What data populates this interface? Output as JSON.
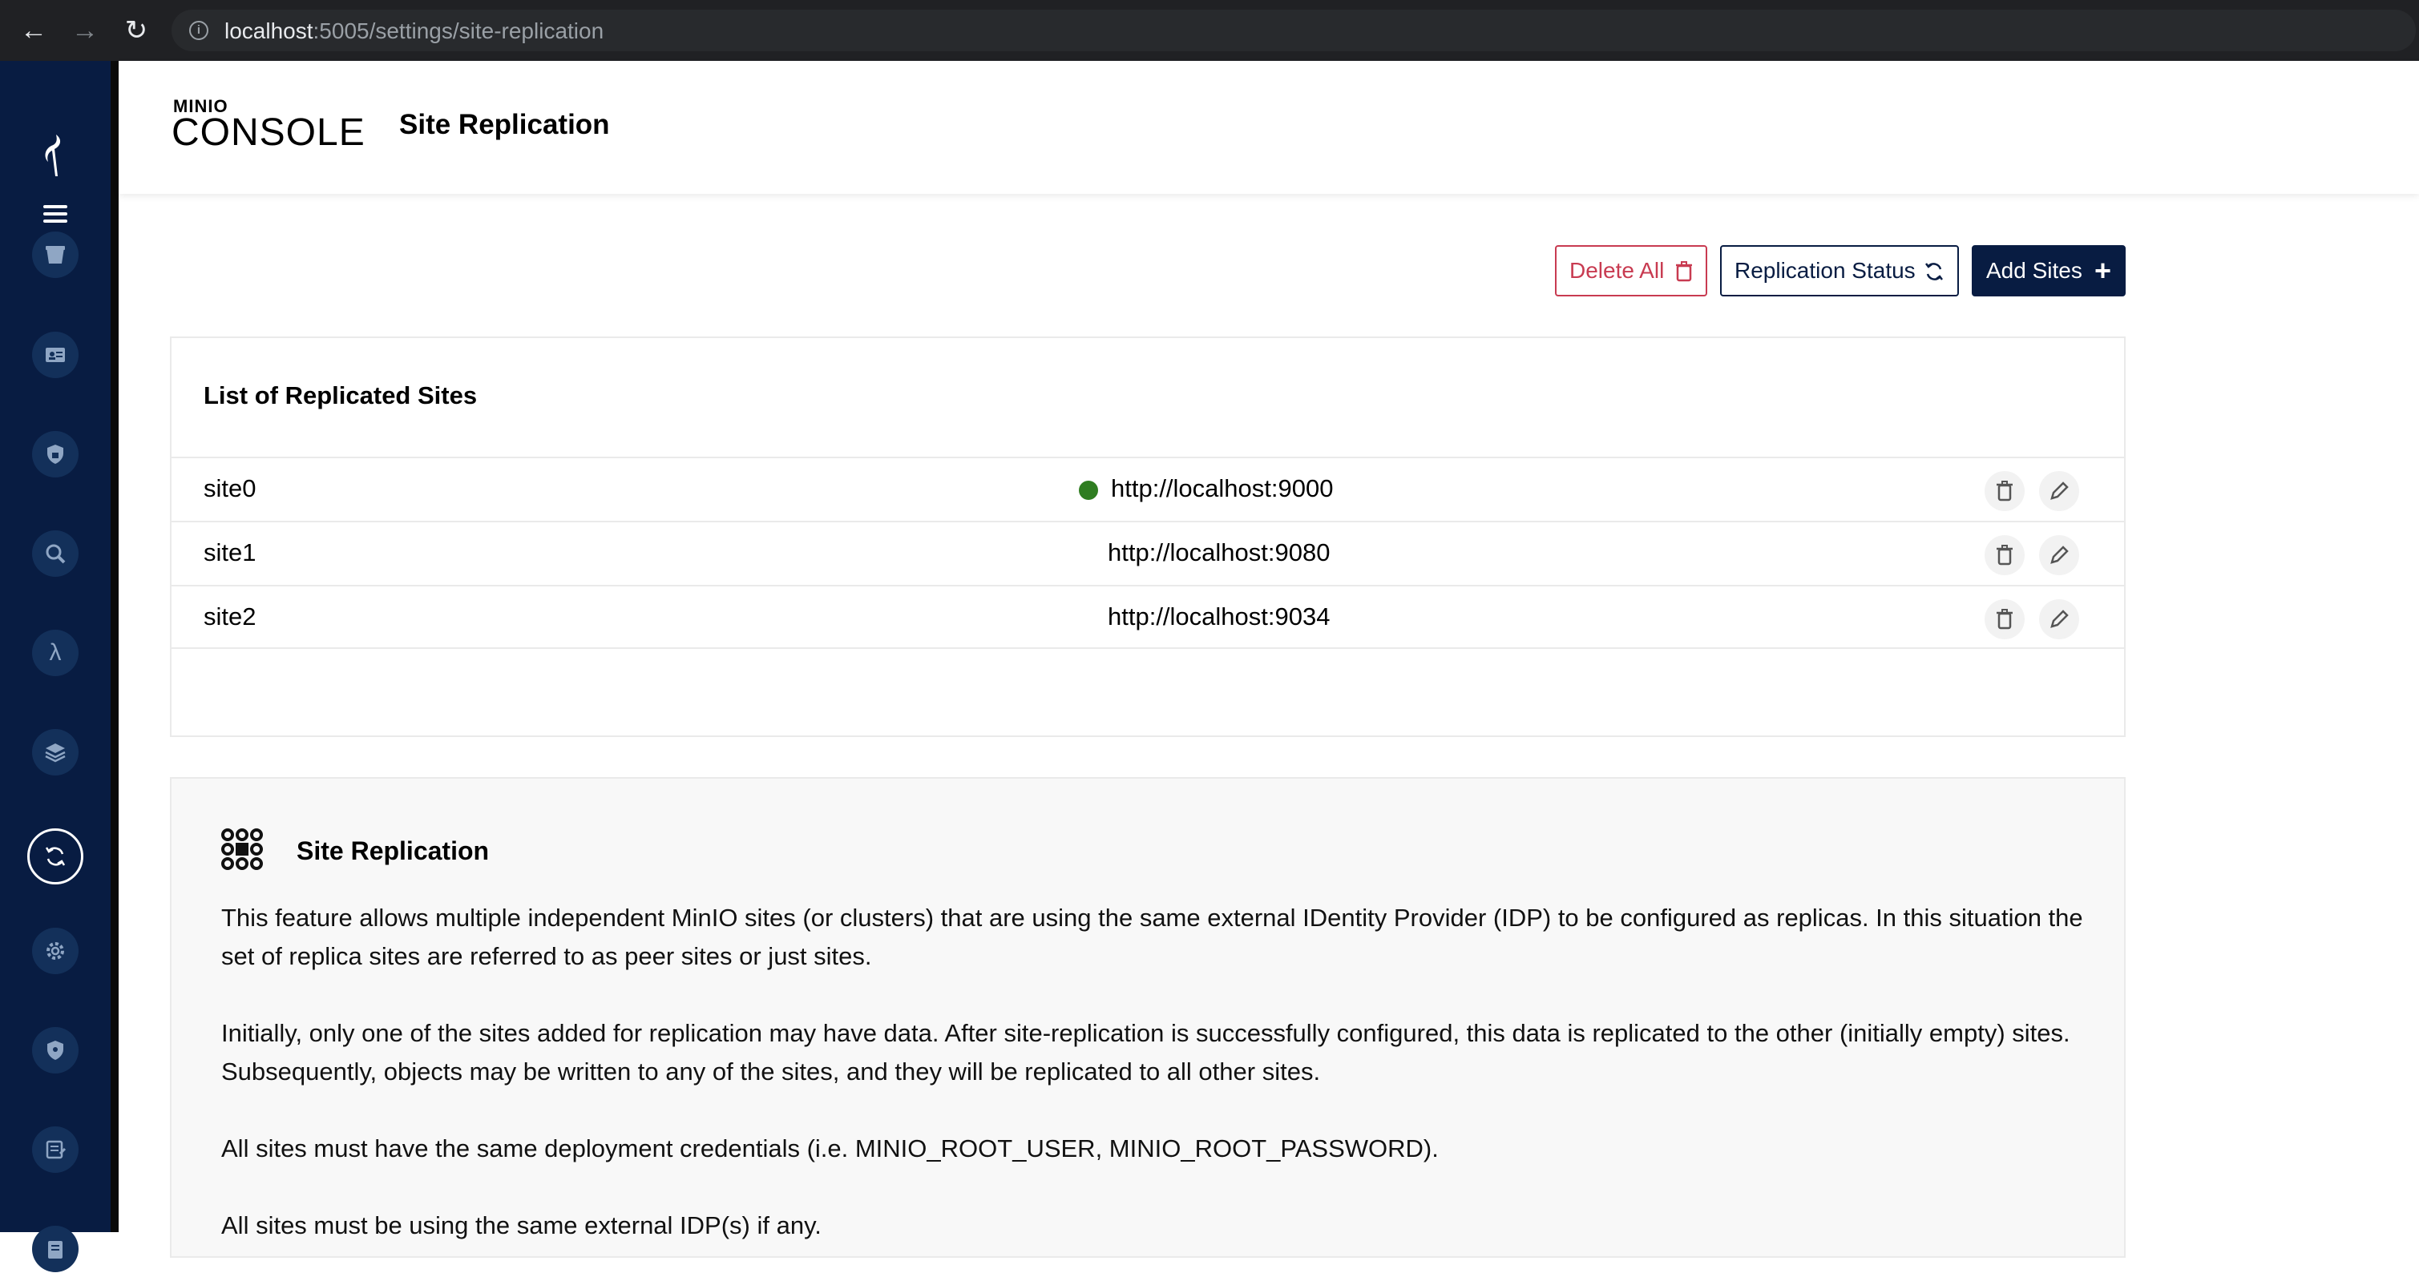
{
  "browser": {
    "url_host": "localhost",
    "url_path": ":5005/settings/site-replication"
  },
  "header": {
    "brand_top": "MINIO",
    "brand_name": "CONSOLE",
    "page_title": "Site Replication"
  },
  "actions": {
    "delete_all": "Delete All",
    "replication_status": "Replication Status",
    "add_sites": "Add Sites"
  },
  "sites_list": {
    "title": "List of Replicated Sites",
    "rows": [
      {
        "name": "site0",
        "endpoint": "http://localhost:9000",
        "online": true
      },
      {
        "name": "site1",
        "endpoint": "http://localhost:9080",
        "online": false
      },
      {
        "name": "site2",
        "endpoint": "http://localhost:9034",
        "online": false
      }
    ]
  },
  "info": {
    "title": "Site Replication",
    "paragraphs": [
      "This feature allows multiple independent MinIO sites (or clusters) that are using the same external IDentity Provider (IDP) to be configured as replicas. In this situation the set of replica sites are referred to as peer sites or just sites.",
      "Initially, only one of the sites added for replication may have data. After site-replication is successfully configured, this data is replicated to the other (initially empty) sites. Subsequently, objects may be written to any of the sites, and they will be replicated to all other sites.",
      "All sites must have the same deployment credentials (i.e. MINIO_ROOT_USER, MINIO_ROOT_PASSWORD).",
      "All sites must be using the same external IDP(s) if any."
    ]
  },
  "colors": {
    "sidebar_bg": "#081c42",
    "danger": "#c83b51",
    "online_dot": "#2f7d21"
  },
  "sidebar_icons": [
    "bucket-icon",
    "identity-icon",
    "policy-icon",
    "monitoring-icon",
    "lambda-icon",
    "tiers-icon",
    "site-replication-icon",
    "settings-icon",
    "security-icon",
    "logs-icon",
    "documentation-icon"
  ]
}
